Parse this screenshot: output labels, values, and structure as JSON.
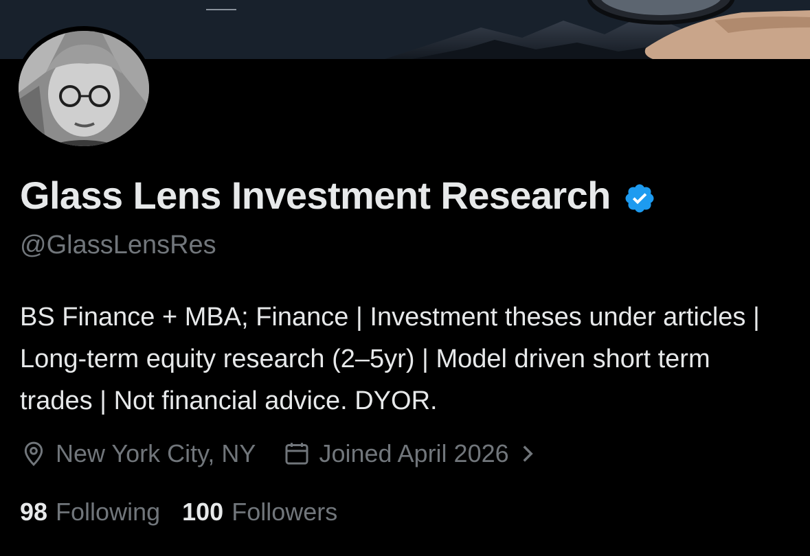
{
  "profile": {
    "display_name": "Glass Lens Investment Research",
    "handle": "@GlassLensRes",
    "verified": true,
    "bio": "BS Finance + MBA; Finance | Investment theses under articles | Long-term equity research (2–5yr) | Model driven short term trades | Not financial advice. DYOR.",
    "location": "New York City, NY",
    "joined": "Joined April 2026",
    "following_count": "98",
    "following_label": "Following",
    "followers_count": "100",
    "followers_label": "Followers"
  },
  "icons": {
    "verified": "verified-badge-icon",
    "location": "location-pin-icon",
    "calendar": "calendar-icon",
    "chevron": "chevron-right-icon"
  },
  "colors": {
    "background": "#000000",
    "text_primary": "#e7e9ea",
    "text_secondary": "#71767b",
    "verified_blue": "#1d9bf0"
  }
}
